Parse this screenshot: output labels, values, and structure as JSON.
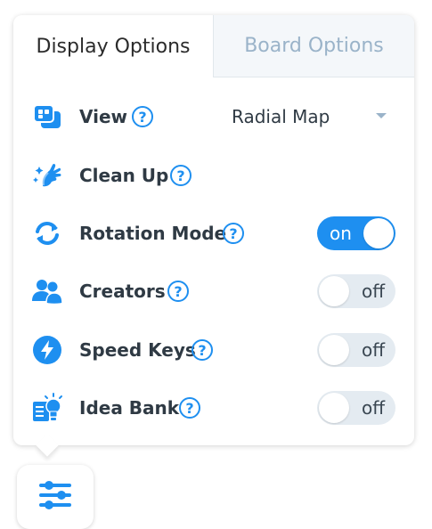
{
  "tabs": {
    "display": "Display Options",
    "board": "Board Options"
  },
  "rows": {
    "view": {
      "label": "View",
      "help": "?",
      "select_value": "Radial Map"
    },
    "clean_up": {
      "label": "Clean Up",
      "help": "?"
    },
    "rotation": {
      "label": "Rotation Mode",
      "help": "?",
      "toggle": "on"
    },
    "creators": {
      "label": "Creators",
      "help": "?",
      "toggle": "off"
    },
    "speed_keys": {
      "label": "Speed Keys",
      "help": "?",
      "toggle": "off"
    },
    "idea_bank": {
      "label": "Idea Bank",
      "help": "?",
      "toggle": "off"
    }
  },
  "colors": {
    "accent": "#1e8ff0",
    "inactive_tab": "#9ab3c9",
    "toggle_off_bg": "#e4ebf1"
  },
  "icons": {
    "view": "view-icon",
    "clean_up": "sparkle-hand-icon",
    "rotation": "rotate-icon",
    "creators": "users-icon",
    "speed_keys": "lightning-icon",
    "idea_bank": "lightbulb-icon",
    "settings": "sliders-icon"
  }
}
